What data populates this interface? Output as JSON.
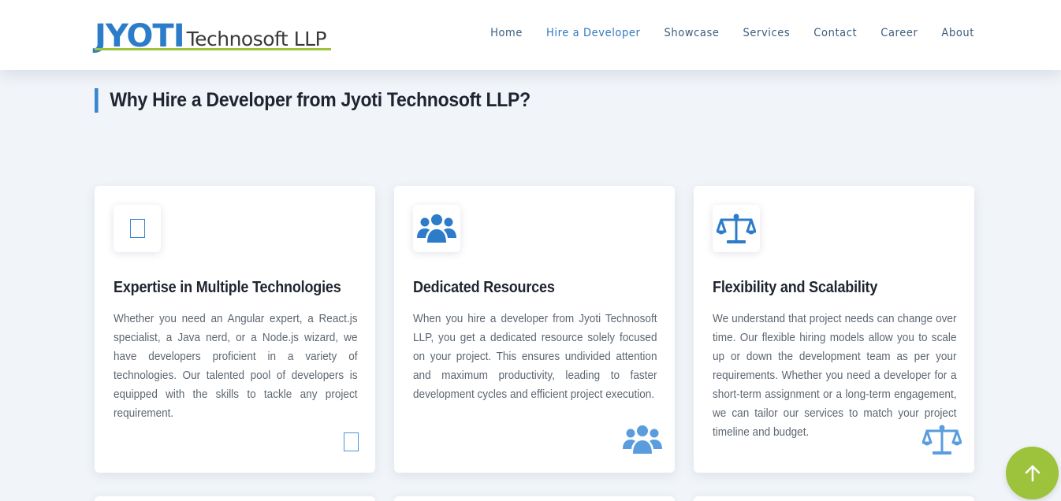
{
  "brand": {
    "name_main": "JYOTI",
    "name_sub": "Technosoft LLP",
    "colors": {
      "primary": "#2d7cc9",
      "accent": "#9cc33b",
      "text_dark": "#1f2430"
    }
  },
  "nav": {
    "items": [
      {
        "label": "Home",
        "active": false
      },
      {
        "label": "Hire a Developer",
        "active": true
      },
      {
        "label": "Showcase",
        "active": false
      },
      {
        "label": "Services",
        "active": false
      },
      {
        "label": "Contact",
        "active": false
      },
      {
        "label": "Career",
        "active": false
      },
      {
        "label": "About",
        "active": false
      }
    ]
  },
  "section": {
    "title": "Why Hire a Developer from Jyoti Technosoft LLP?"
  },
  "cards": [
    {
      "icon": "missing-glyph-icon",
      "title": "Expertise in Multiple Technologies",
      "text": "Whether you need an Angular expert, a React.js specialist, a Java nerd, or a Node.js wizard, we have developers proficient in a variety of technologies. Our talented pool of developers is equipped with the skills to tackle any project requirement."
    },
    {
      "icon": "users-icon",
      "title": "Dedicated Resources",
      "text": "When you hire a developer from Jyoti Technosoft LLP, you get a dedicated resource solely focused on your project. This ensures undivided attention and maximum productivity, leading to faster development cycles and efficient project execution."
    },
    {
      "icon": "balance-scale-icon",
      "title": "Flexibility and Scalability",
      "text": "We understand that project needs can change over time. Our flexible hiring models allow you to scale up or down the development team as per your requirements. Whether you need a developer for a short-term assignment or a long-term engagement, we can tailor our services to match your project timeline and budget."
    }
  ],
  "back_to_top": {
    "icon": "arrow-up-icon"
  }
}
